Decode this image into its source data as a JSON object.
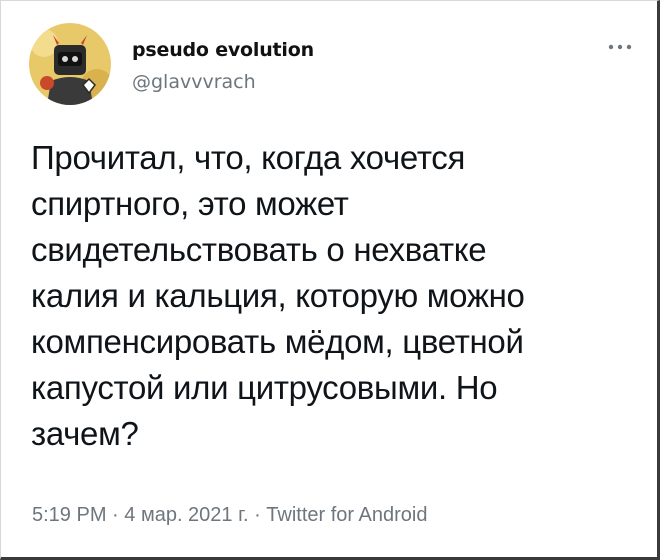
{
  "author": {
    "name": "pseudo evolution",
    "handle": "@glavvvrach"
  },
  "tweet": {
    "lines": [
      "Прочитал, что, когда хочется",
      "спиртного, это может",
      "свидетельствовать о нехватке",
      "калия и кальция, которую можно",
      "компенсировать мёдом, цветной",
      "капустой или цитрусовыми. Но",
      "зачем?"
    ]
  },
  "meta": {
    "time": "5:19 PM",
    "separator": " · ",
    "date": "4 мар. 2021 г.",
    "source": "Twitter for Android"
  },
  "icons": {
    "avatar": "avatar-robot-icon",
    "more": "more-options-icon"
  },
  "colors": {
    "text": "#0f1419",
    "secondary": "#6e767d",
    "avatar_bg": "#e8c96a",
    "avatar_figure": "#2b2b2b",
    "avatar_accent": "#c94a2a"
  }
}
